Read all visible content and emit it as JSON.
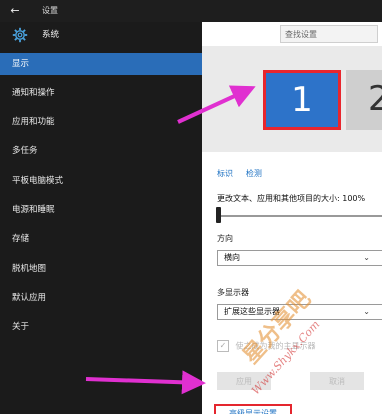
{
  "window": {
    "back_glyph": "←",
    "title": "设置"
  },
  "nav": {
    "header_label": "系统",
    "items": [
      {
        "label": "显示",
        "active": true
      },
      {
        "label": "通知和操作"
      },
      {
        "label": "应用和功能"
      },
      {
        "label": "多任务"
      },
      {
        "label": "平板电脑模式"
      },
      {
        "label": "电源和睡眠"
      },
      {
        "label": "存储"
      },
      {
        "label": "脱机地图"
      },
      {
        "label": "默认应用"
      },
      {
        "label": "关于"
      }
    ]
  },
  "search": {
    "placeholder": "查找设置"
  },
  "display_preview": {
    "monitor_1": "1",
    "monitor_2": "2"
  },
  "links": {
    "identify": "标识",
    "detect": "检测"
  },
  "scale": {
    "label": "更改文本、应用和其他项目的大小: 100%"
  },
  "orientation": {
    "label": "方向",
    "value": "横向"
  },
  "multi_display": {
    "label": "多显示器",
    "value": "扩展这些显示器"
  },
  "checkbox": {
    "label": "使之成为我的主显示器",
    "glyph": "✓"
  },
  "buttons": {
    "apply": "应用",
    "cancel": "取消"
  },
  "advanced_link": "高级显示设置",
  "watermark": {
    "brand": "星分享吧",
    "url": "Www.Shykx.Com"
  },
  "colors": {
    "accent": "#2a6db8",
    "annotation": "#e030d0",
    "highlight": "#e4262e"
  }
}
